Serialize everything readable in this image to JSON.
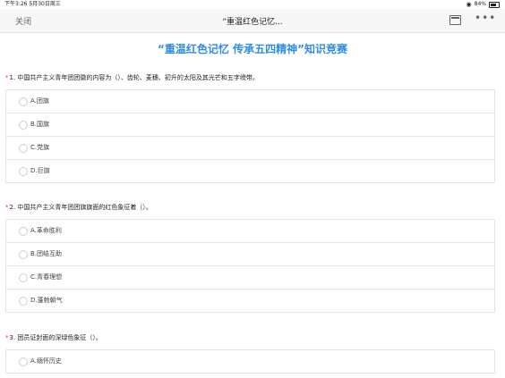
{
  "status": {
    "time": "下午3:26",
    "date": "5月30日周三",
    "battery": "84%"
  },
  "nav": {
    "close": "关闭",
    "title": "“重温红色记忆..."
  },
  "page_title": "“重温红色记忆 传承五四精神”知识竞赛",
  "questions": [
    {
      "number": "1.",
      "text": "中国共产主义青年团团徽的内容为（）、齿轮、麦穗、初升的太阳及其光芒和五字绶带。",
      "options": [
        "A.团旗",
        "B.国旗",
        "C.党旗",
        "D.巨旗"
      ]
    },
    {
      "number": "2.",
      "text": "中国共产主义青年团团旗旗面的红色象征着（）。",
      "options": [
        "A.革命胜利",
        "B.团结互助",
        "C.青春理想",
        "D.蓬勃朝气"
      ]
    },
    {
      "number": "3.",
      "text": "团员证封面的深绿色象征（）。",
      "options": [
        "A.缅怀历史"
      ]
    }
  ]
}
